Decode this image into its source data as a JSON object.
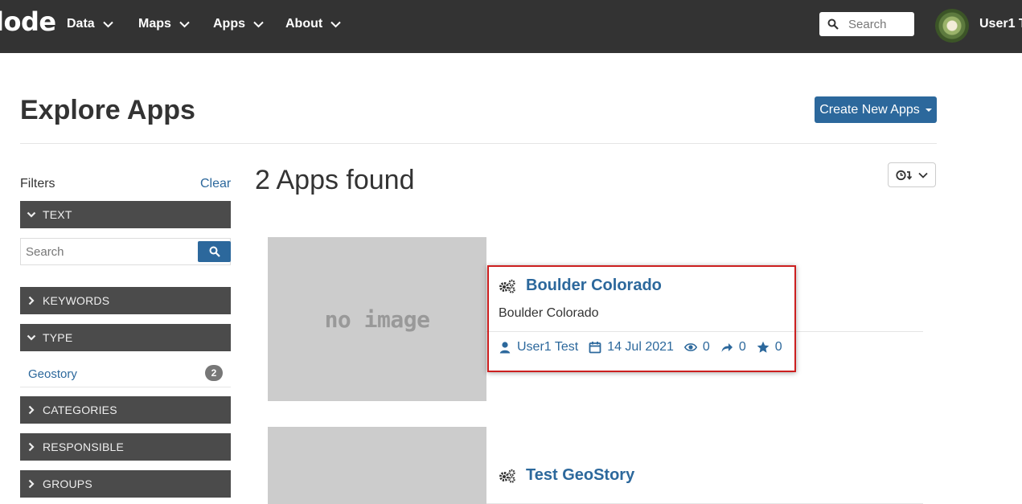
{
  "navbar": {
    "brand": "lode",
    "items": [
      {
        "label": "Data"
      },
      {
        "label": "Maps"
      },
      {
        "label": "Apps"
      },
      {
        "label": "About"
      }
    ],
    "search_placeholder": "Search",
    "user_name": "User1 T"
  },
  "header": {
    "title": "Explore Apps",
    "create_button": "Create New Apps"
  },
  "filters": {
    "label": "Filters",
    "clear": "Clear",
    "search_placeholder": "Search",
    "facets": {
      "text": "TEXT",
      "keywords": "KEYWORDS",
      "type": "TYPE",
      "categories": "CATEGORIES",
      "responsible": "RESPONSIBLE",
      "groups": "GROUPS"
    },
    "type_options": [
      {
        "label": "Geostory",
        "count": "2"
      }
    ]
  },
  "results": {
    "title": "2 Apps found",
    "placeholder_text": "no image",
    "items": [
      {
        "title": "Boulder Colorado",
        "description": "Boulder Colorado",
        "owner": "User1 Test",
        "date": "14 Jul 2021",
        "views": "0",
        "shares": "0",
        "favorites": "0"
      },
      {
        "title": "Test GeoStory"
      }
    ]
  },
  "colors": {
    "navbar": "#333333",
    "accent": "#2c689c",
    "facet": "#4b4b4b",
    "highlight": "#cc1f1f"
  }
}
